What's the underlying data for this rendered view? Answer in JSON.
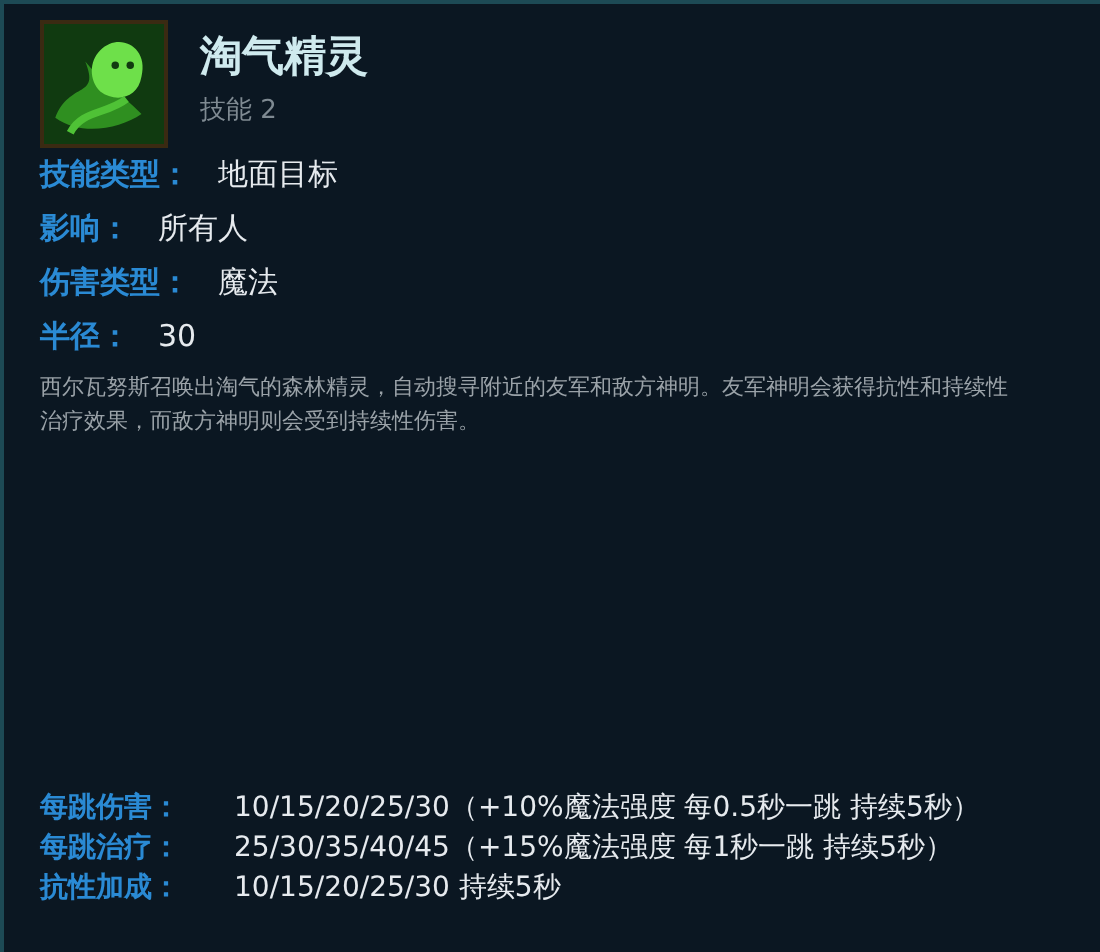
{
  "title": "淘气精灵",
  "subtitle": "技能 2",
  "attributes": [
    {
      "label": "技能类型：",
      "value": "地面目标"
    },
    {
      "label": "影响：",
      "value": "所有人"
    },
    {
      "label": "伤害类型：",
      "value": "魔法"
    },
    {
      "label": "半径：",
      "value": "30"
    }
  ],
  "description": "西尔瓦努斯召唤出淘气的森林精灵，自动搜寻附近的友军和敌方神明。友军神明会获得抗性和持续性治疗效果，而敌方神明则会受到持续性伤害。",
  "effects": [
    {
      "label": "每跳伤害：",
      "value": "10/15/20/25/30（+10%魔法强度 每0.5秒一跳 持续5秒）"
    },
    {
      "label": "每跳治疗：",
      "value": "25/30/35/40/45（+15%魔法强度 每1秒一跳 持续5秒）"
    },
    {
      "label": "抗性加成：",
      "value": "10/15/20/25/30 持续5秒"
    }
  ]
}
